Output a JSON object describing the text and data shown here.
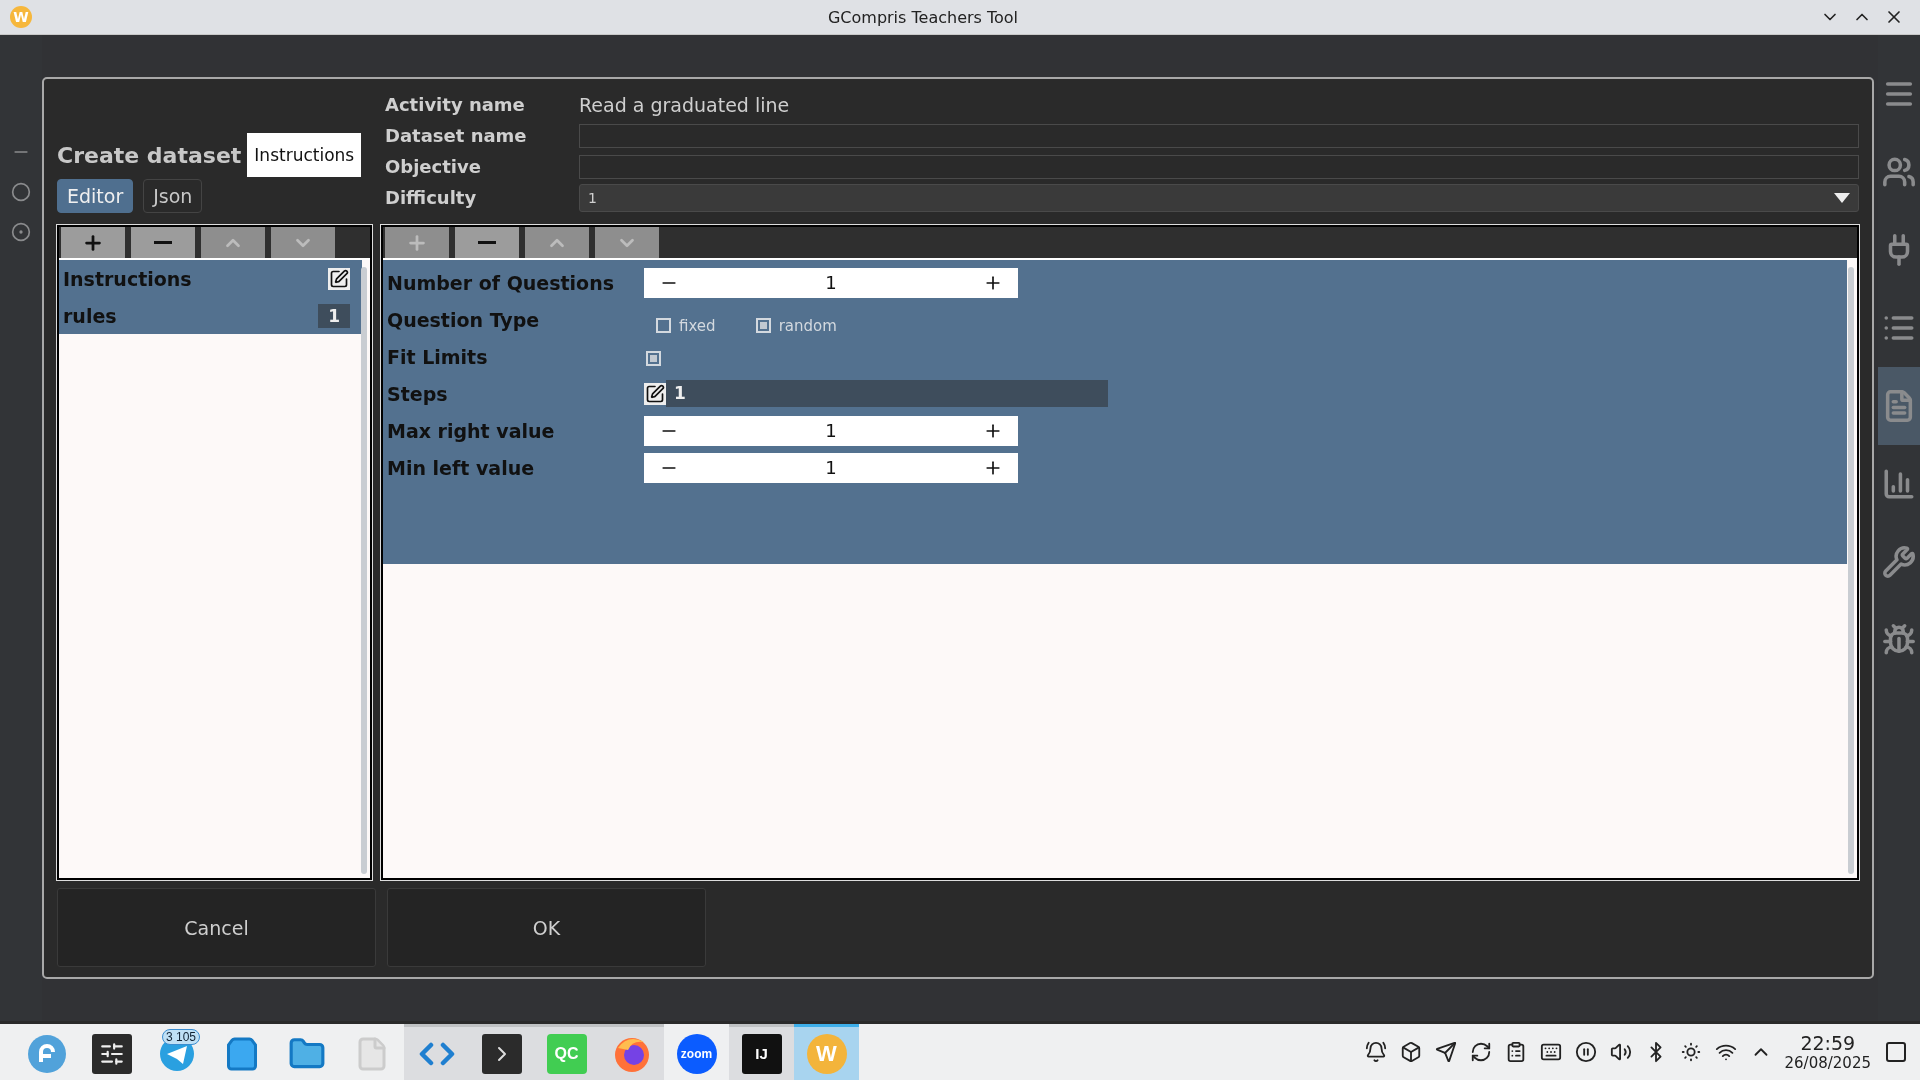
{
  "window": {
    "title": "GCompris Teachers Tool",
    "logo": "W"
  },
  "background": {
    "left_rail": [
      {
        "kind": "minus"
      },
      {
        "kind": "circle"
      },
      {
        "kind": "radio"
      }
    ],
    "right_rail": [
      {
        "kind": "menu",
        "selected": false
      },
      {
        "kind": "people",
        "selected": false
      },
      {
        "kind": "plug",
        "selected": false
      },
      {
        "kind": "list",
        "selected": false
      },
      {
        "kind": "document",
        "selected": true
      },
      {
        "kind": "chart",
        "selected": false
      },
      {
        "kind": "wrench",
        "selected": false
      },
      {
        "kind": "bug",
        "selected": false
      }
    ]
  },
  "dialog": {
    "title": "Create dataset",
    "section": "Instructions",
    "modes": [
      {
        "label": "Editor",
        "selected": true
      },
      {
        "label": "Json",
        "selected": false
      }
    ],
    "fields": [
      {
        "label": "Activity name",
        "kind": "text",
        "value": "Read a graduated line"
      },
      {
        "label": "Dataset name",
        "kind": "input"
      },
      {
        "label": "Objective",
        "kind": "input"
      },
      {
        "label": "Difficulty",
        "kind": "combo",
        "value": "1"
      }
    ],
    "left_toolbar": [
      {
        "kind": "add",
        "disabled": false
      },
      {
        "kind": "remove",
        "disabled": false
      },
      {
        "kind": "up",
        "disabled": true
      },
      {
        "kind": "down",
        "disabled": true
      }
    ],
    "items": [
      {
        "label": "Instructions",
        "kind": "edit"
      },
      {
        "label": "rules",
        "kind": "value",
        "value": "1"
      }
    ],
    "right_toolbar": [
      {
        "kind": "add",
        "disabled": true
      },
      {
        "kind": "remove",
        "disabled": false
      },
      {
        "kind": "up",
        "disabled": true
      },
      {
        "kind": "down",
        "disabled": true
      }
    ],
    "rows": [
      {
        "label": "Number of Questions",
        "kind": "spin",
        "value": "1"
      },
      {
        "label": "Question Type",
        "kind": "choice",
        "options": [
          {
            "label": "fixed",
            "selected": false
          },
          {
            "label": "random",
            "selected": true
          }
        ]
      },
      {
        "label": "Fit Limits",
        "kind": "check",
        "checked": true
      },
      {
        "label": "Steps",
        "kind": "text",
        "value": "1"
      },
      {
        "label": "Max right value",
        "kind": "spin",
        "value": "1"
      },
      {
        "label": "Min left value",
        "kind": "spin",
        "value": "1"
      }
    ],
    "buttons": [
      "Cancel",
      "OK"
    ]
  },
  "taskbar": {
    "apps": [
      {
        "kind": "fedora",
        "running": false,
        "selected": false
      },
      {
        "kind": "settings",
        "running": false,
        "selected": false
      },
      {
        "kind": "telegram",
        "running": false,
        "selected": false,
        "badge": "3 105"
      },
      {
        "kind": "store",
        "running": false,
        "selected": false
      },
      {
        "kind": "folder",
        "running": false,
        "selected": false
      },
      {
        "kind": "file",
        "running": false,
        "selected": false
      },
      {
        "kind": "vscode",
        "running": true,
        "selected": false
      },
      {
        "kind": "terminal",
        "running": true,
        "selected": false
      },
      {
        "kind": "qtcreator",
        "running": true,
        "selected": false,
        "label": "QC"
      },
      {
        "kind": "firefox",
        "running": true,
        "selected": false
      },
      {
        "kind": "zoom",
        "running": false,
        "selected": false,
        "label": "zoom"
      },
      {
        "kind": "intellij",
        "running": true,
        "selected": false,
        "label": "IJ"
      },
      {
        "kind": "gcompris",
        "running": true,
        "selected": true,
        "label": "W"
      }
    ],
    "tray": [
      {
        "kind": "bell"
      },
      {
        "kind": "toolbox"
      },
      {
        "kind": "telegram"
      },
      {
        "kind": "update"
      },
      {
        "kind": "clipboard"
      },
      {
        "kind": "keyboard"
      },
      {
        "kind": "pause"
      },
      {
        "kind": "volume"
      },
      {
        "kind": "bluetooth"
      },
      {
        "kind": "brightness"
      },
      {
        "kind": "wifi"
      },
      {
        "kind": "expand"
      }
    ],
    "time": "22:59",
    "date": "26/08/2025"
  }
}
